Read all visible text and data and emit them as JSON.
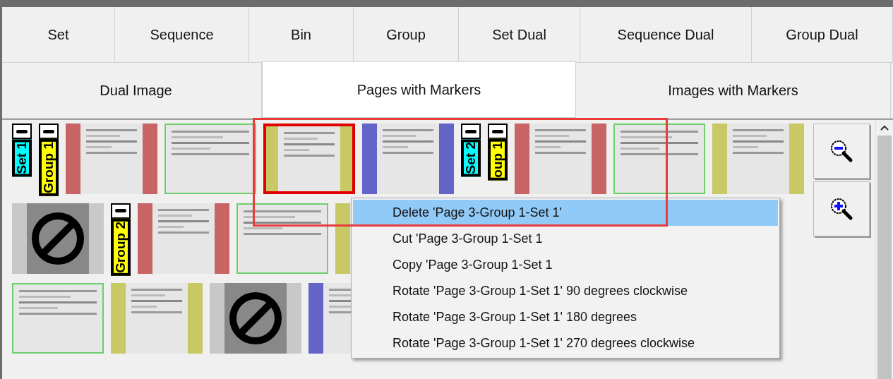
{
  "tabs_row_1": [
    {
      "label": "Set",
      "selected": false
    },
    {
      "label": "Sequence",
      "selected": false
    },
    {
      "label": "Bin",
      "selected": false
    },
    {
      "label": "Group",
      "selected": false
    },
    {
      "label": "Set Dual",
      "selected": false
    },
    {
      "label": "Sequence Dual",
      "selected": false
    },
    {
      "label": "Group Dual",
      "selected": false
    }
  ],
  "tabs_row_2": [
    {
      "label": "Dual Image",
      "selected": false
    },
    {
      "label": "Pages with Markers",
      "selected": true
    },
    {
      "label": "Images with Markers",
      "selected": false
    }
  ],
  "thumbnail_rows": [
    [
      {
        "kind": "marker",
        "label": "Set 1",
        "color": "#00ffff"
      },
      {
        "kind": "marker",
        "label": "Group 1",
        "color": "#ffff00"
      },
      {
        "kind": "page",
        "color": "#c86464",
        "selected": false
      },
      {
        "kind": "page",
        "color": "#6ccf6c",
        "selected": false
      },
      {
        "kind": "page",
        "color": "#c8c864",
        "selected": true
      },
      {
        "kind": "page",
        "color": "#6464c8",
        "selected": false
      },
      {
        "kind": "marker",
        "label": "Set 2",
        "color": "#00ffff"
      },
      {
        "kind": "marker",
        "label": "oup 1",
        "color": "#ffff00"
      },
      {
        "kind": "page",
        "color": "#c86464",
        "selected": false
      },
      {
        "kind": "page",
        "color": "#6ccf6c",
        "selected": false
      },
      {
        "kind": "page",
        "color": "#c8c864",
        "selected": false
      }
    ],
    [
      {
        "kind": "blank",
        "color": "#c8c8c8",
        "selected": false
      },
      {
        "kind": "marker",
        "label": "Group 2",
        "color": "#ffff00"
      },
      {
        "kind": "page",
        "color": "#c86464",
        "selected": false
      },
      {
        "kind": "page",
        "color": "#6ccf6c",
        "selected": false
      },
      {
        "kind": "page",
        "color": "#c8c864",
        "selected": false
      }
    ],
    [
      {
        "kind": "page",
        "color": "#6ccf6c",
        "selected": false
      },
      {
        "kind": "page",
        "color": "#c8c864",
        "selected": false
      },
      {
        "kind": "blank",
        "color": "#c8c8c8",
        "selected": false
      },
      {
        "kind": "page",
        "color": "#6464c8",
        "selected": false
      }
    ]
  ],
  "context_menu": [
    {
      "label": "Delete 'Page 3-Group 1-Set 1'",
      "selected": true
    },
    {
      "label": "Cut 'Page 3-Group 1-Set 1",
      "selected": false
    },
    {
      "label": "Copy 'Page 3-Group 1-Set 1",
      "selected": false
    },
    {
      "label": "Rotate 'Page 3-Group 1-Set 1' 90 degrees clockwise",
      "selected": false
    },
    {
      "label": "Rotate 'Page 3-Group 1-Set 1' 180 degrees",
      "selected": false
    },
    {
      "label": "Rotate 'Page 3-Group 1-Set 1' 270 degrees clockwise",
      "selected": false
    }
  ]
}
